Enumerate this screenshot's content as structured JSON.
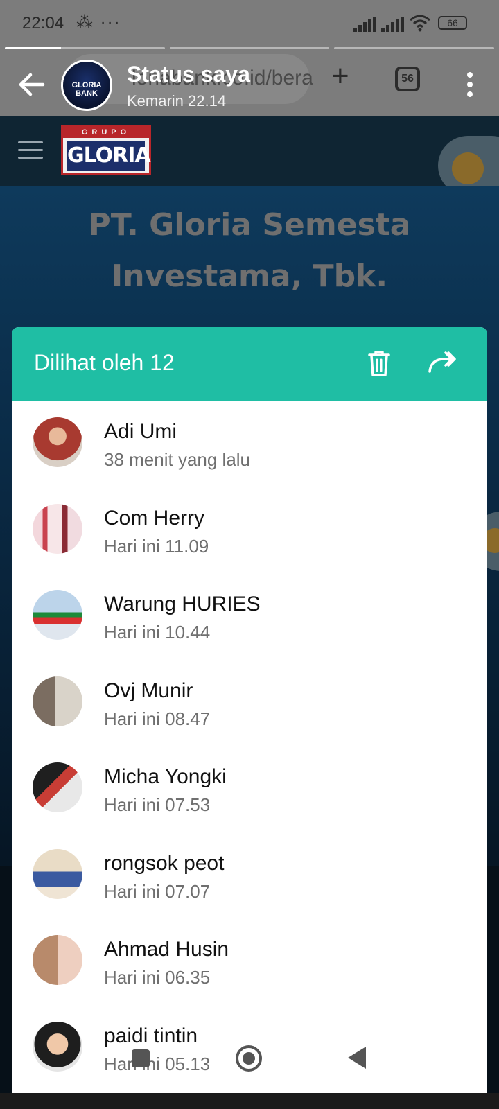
{
  "status_bar": {
    "time": "22:04",
    "extra": "⁂ ···",
    "battery": "66"
  },
  "background_page": {
    "url_fragment": "lonabank.co.id/bera",
    "tab_count": "56",
    "logo_top": "GRUPO",
    "logo_name": "GLORIA",
    "hero_line1": "PT. Gloria Semesta",
    "hero_line2": "Investama, Tbk."
  },
  "progress": {
    "segments": 3,
    "current_fraction": 0.35
  },
  "status_header": {
    "title": "Status saya",
    "time": "Kemarin 22.14",
    "avatar_text": "GLORIA BANK"
  },
  "viewers_sheet": {
    "title": "Dilihat oleh 12",
    "accent_color": "#1fbea4",
    "viewers": [
      {
        "name": "Adi Umi",
        "time": "38 menit yang lalu"
      },
      {
        "name": "Com Herry",
        "time": "Hari ini 11.09"
      },
      {
        "name": "Warung HURIES",
        "time": "Hari ini 10.44"
      },
      {
        "name": "Ovj Munir",
        "time": "Hari ini 08.47"
      },
      {
        "name": "Micha Yongki",
        "time": "Hari ini 07.53"
      },
      {
        "name": "rongsok peot",
        "time": "Hari ini 07.07"
      },
      {
        "name": "Ahmad Husin",
        "time": "Hari ini 06.35"
      },
      {
        "name": "paidi tintin",
        "time": "Hari ini 05.13"
      }
    ]
  },
  "icons": {
    "back": "arrow-left-icon",
    "menu": "more-vert-icon",
    "delete": "trash-icon",
    "forward": "forward-icon"
  }
}
